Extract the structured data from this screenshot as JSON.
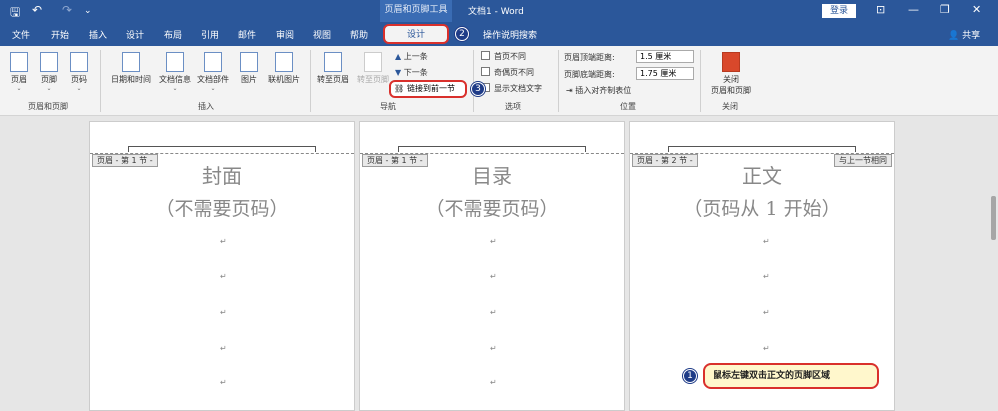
{
  "titlebar": {
    "context_title": "页眉和页脚工具",
    "doc_title": "文档1  -  Word",
    "login": "登录",
    "share": "共享"
  },
  "tabs": [
    "文件",
    "开始",
    "插入",
    "设计",
    "布局",
    "引用",
    "邮件",
    "审阅",
    "视图",
    "帮助"
  ],
  "active_tab": "设计",
  "help_search": "操作说明搜索",
  "ribbon": {
    "header_footer_group": {
      "label": "页眉和页脚",
      "items": [
        "页眉",
        "页脚",
        "页码"
      ]
    },
    "insert_group": {
      "label": "插入",
      "items": [
        "日期和时间",
        "文档信息",
        "文档部件",
        "图片",
        "联机图片"
      ]
    },
    "nav_group": {
      "label": "导航",
      "goto_header": "转至页眉",
      "goto_footer": "转至页脚",
      "prev": "上一条",
      "next": "下一条",
      "link_prev": "链接到前一节"
    },
    "options_group": {
      "label": "选项",
      "items": [
        "首页不同",
        "奇偶页不同",
        "显示文档文字"
      ]
    },
    "position_group": {
      "label": "位置",
      "header_dist_label": "页眉顶端距离:",
      "header_dist": "1.5 厘米",
      "footer_dist_label": "页脚底端距离:",
      "footer_dist": "1.75 厘米",
      "align_tab": "插入对齐制表位"
    },
    "close_group": {
      "label": "关闭",
      "close_btn": "关闭\n页眉和页脚"
    }
  },
  "pages": [
    {
      "tag": "页眉 - 第 1 节 -",
      "title": "封面",
      "subtitle": "（不需要页码）"
    },
    {
      "tag": "页眉 - 第 1 节 -",
      "title": "目录",
      "subtitle": "（不需要页码）"
    },
    {
      "tag": "页眉 - 第 2 节 -",
      "title": "正文",
      "subtitle": "（页码从 1 开始）",
      "right_tag": "与上一节相同"
    }
  ],
  "badges": [
    "1",
    "2",
    "3"
  ],
  "callout": "鼠标左键双击正文的页脚区域",
  "accent": "#2b579a",
  "highlight": "#d9302c"
}
